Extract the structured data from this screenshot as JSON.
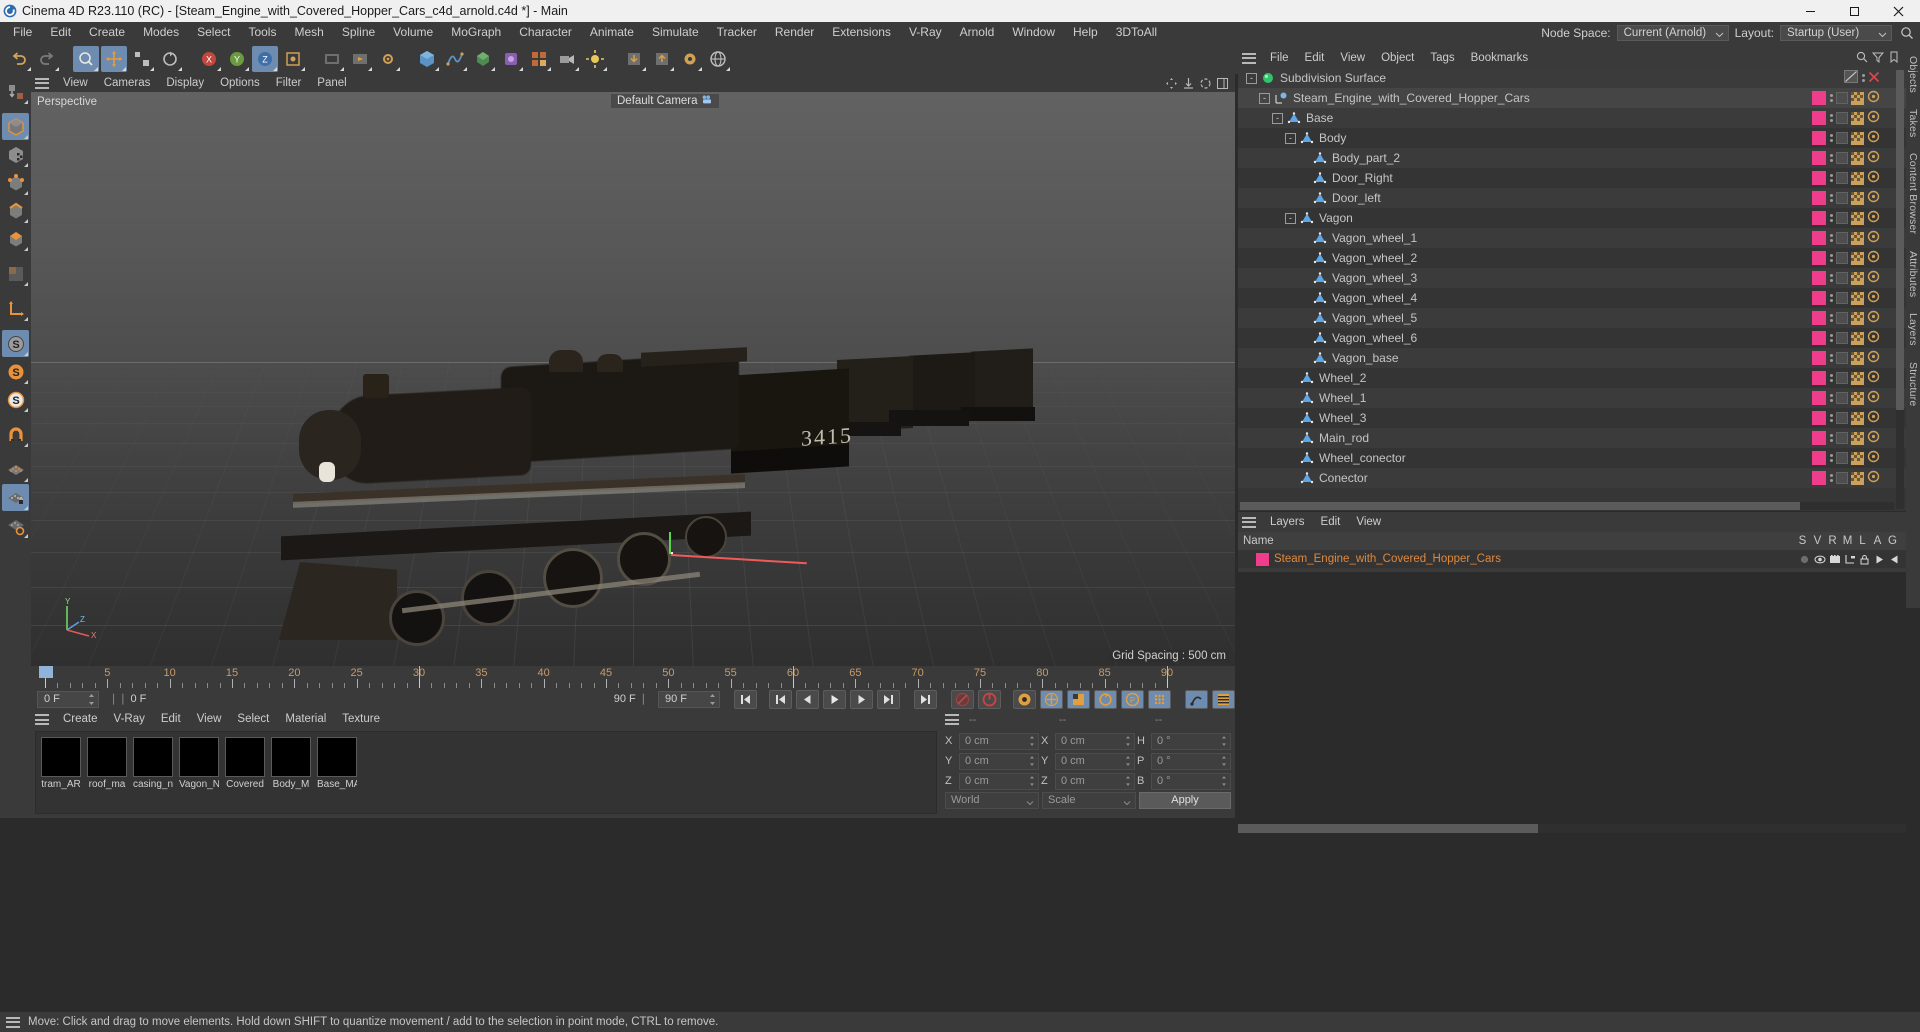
{
  "titlebar": {
    "title": "Cinema 4D R23.110 (RC) - [Steam_Engine_with_Covered_Hopper_Cars_c4d_arnold.c4d *] - Main",
    "minimize": "–",
    "maximize": "❐",
    "close": "✕"
  },
  "menubar": {
    "items": [
      "File",
      "Edit",
      "Create",
      "Modes",
      "Select",
      "Tools",
      "Mesh",
      "Spline",
      "Volume",
      "MoGraph",
      "Character",
      "Animate",
      "Simulate",
      "Tracker",
      "Render",
      "Extensions",
      "V-Ray",
      "Arnold",
      "Window",
      "Help",
      "3DToAll"
    ],
    "node_space_label": "Node Space:",
    "node_space_value": "Current (Arnold)",
    "layout_label": "Layout:",
    "layout_value": "Startup (User)"
  },
  "viewport": {
    "menus": [
      "View",
      "Cameras",
      "Display",
      "Options",
      "Filter",
      "Panel"
    ],
    "label": "Perspective",
    "camera": "Default Camera",
    "grid_spacing": "Grid Spacing : 500 cm",
    "axis": {
      "x": "X",
      "y": "Y",
      "z": "Z"
    }
  },
  "timeline": {
    "ticks": [
      0,
      5,
      10,
      15,
      20,
      25,
      30,
      35,
      40,
      45,
      50,
      55,
      60,
      65,
      70,
      75,
      80,
      85,
      90
    ],
    "current_frame": "0 F",
    "current_frame_2": "0 F",
    "end_frame_display": "90 F",
    "end_frame": "90 F",
    "preview_end": "0 F",
    "buttons": [
      "go-to-start",
      "previous-key",
      "previous-frame",
      "play",
      "next-frame",
      "next-key",
      "go-to-end",
      "record-active-objects",
      "autokeying",
      "keyframe-selection",
      "position",
      "scale",
      "rotation",
      "parameter",
      "point-level-animation",
      "animation-mode",
      "timeline-mode"
    ]
  },
  "material_manager": {
    "menus": [
      "Create",
      "V-Ray",
      "Edit",
      "View",
      "Select",
      "Material",
      "Texture"
    ],
    "materials": [
      {
        "name": "tram_AR",
        "color": "#000000"
      },
      {
        "name": "roof_ma",
        "color": "#000000"
      },
      {
        "name": "casing_n",
        "color": "#000000"
      },
      {
        "name": "Vagon_N",
        "color": "#000000"
      },
      {
        "name": "Covered",
        "color": "#000000"
      },
      {
        "name": "Body_M",
        "color": "#000000"
      },
      {
        "name": "Base_MA",
        "color": "#000000"
      }
    ]
  },
  "coordinates": {
    "header": [
      "--",
      "--",
      "--"
    ],
    "rows": [
      {
        "pos_label": "X",
        "pos_value": "0 cm",
        "size_label": "X",
        "size_value": "0 cm",
        "rot_label": "H",
        "rot_value": "0 °"
      },
      {
        "pos_label": "Y",
        "pos_value": "0 cm",
        "size_label": "Y",
        "size_value": "0 cm",
        "rot_label": "P",
        "rot_value": "0 °"
      },
      {
        "pos_label": "Z",
        "pos_value": "0 cm",
        "size_label": "Z",
        "size_value": "0 cm",
        "rot_label": "B",
        "rot_value": "0 °"
      }
    ],
    "system": "World",
    "mode": "Scale",
    "apply": "Apply"
  },
  "object_manager": {
    "menus": [
      "File",
      "Edit",
      "View",
      "Object",
      "Tags",
      "Bookmarks"
    ],
    "items": [
      {
        "name": "Subdivision Surface",
        "depth": 0,
        "icon": "subdivision-surface",
        "expander": "-",
        "selected": false,
        "tag": "none"
      },
      {
        "name": "Steam_Engine_with_Covered_Hopper_Cars",
        "depth": 1,
        "icon": "null-object",
        "expander": "-",
        "selected": true,
        "tag": "pink"
      },
      {
        "name": "Base",
        "depth": 2,
        "icon": "polygon-object",
        "expander": "-",
        "selected": false,
        "tag": "pink"
      },
      {
        "name": "Body",
        "depth": 3,
        "icon": "polygon-object",
        "expander": "-",
        "selected": false,
        "tag": "pink"
      },
      {
        "name": "Body_part_2",
        "depth": 4,
        "icon": "polygon-object",
        "expander": "",
        "selected": false,
        "tag": "pink"
      },
      {
        "name": "Door_Right",
        "depth": 4,
        "icon": "polygon-object",
        "expander": "",
        "selected": false,
        "tag": "pink"
      },
      {
        "name": "Door_left",
        "depth": 4,
        "icon": "polygon-object",
        "expander": "",
        "selected": false,
        "tag": "pink"
      },
      {
        "name": "Vagon",
        "depth": 3,
        "icon": "polygon-object",
        "expander": "-",
        "selected": false,
        "tag": "pink"
      },
      {
        "name": "Vagon_wheel_1",
        "depth": 4,
        "icon": "polygon-object",
        "expander": "",
        "selected": false,
        "tag": "pink"
      },
      {
        "name": "Vagon_wheel_2",
        "depth": 4,
        "icon": "polygon-object",
        "expander": "",
        "selected": false,
        "tag": "pink"
      },
      {
        "name": "Vagon_wheel_3",
        "depth": 4,
        "icon": "polygon-object",
        "expander": "",
        "selected": false,
        "tag": "pink"
      },
      {
        "name": "Vagon_wheel_4",
        "depth": 4,
        "icon": "polygon-object",
        "expander": "",
        "selected": false,
        "tag": "pink"
      },
      {
        "name": "Vagon_wheel_5",
        "depth": 4,
        "icon": "polygon-object",
        "expander": "",
        "selected": false,
        "tag": "pink"
      },
      {
        "name": "Vagon_wheel_6",
        "depth": 4,
        "icon": "polygon-object",
        "expander": "",
        "selected": false,
        "tag": "pink"
      },
      {
        "name": "Vagon_base",
        "depth": 4,
        "icon": "polygon-object",
        "expander": "",
        "selected": false,
        "tag": "pink"
      },
      {
        "name": "Wheel_2",
        "depth": 3,
        "icon": "polygon-object",
        "expander": "",
        "selected": false,
        "tag": "pink"
      },
      {
        "name": "Wheel_1",
        "depth": 3,
        "icon": "polygon-object",
        "expander": "",
        "selected": false,
        "tag": "pink"
      },
      {
        "name": "Wheel_3",
        "depth": 3,
        "icon": "polygon-object",
        "expander": "",
        "selected": false,
        "tag": "pink"
      },
      {
        "name": "Main_rod",
        "depth": 3,
        "icon": "polygon-object",
        "expander": "",
        "selected": false,
        "tag": "pink"
      },
      {
        "name": "Wheel_conector",
        "depth": 3,
        "icon": "polygon-object",
        "expander": "",
        "selected": false,
        "tag": "pink"
      },
      {
        "name": "Conector",
        "depth": 3,
        "icon": "polygon-object",
        "expander": "",
        "selected": false,
        "tag": "pink"
      }
    ]
  },
  "layers": {
    "menus": [
      "Layers",
      "Edit",
      "View"
    ],
    "name_header": "Name",
    "columns": [
      "S",
      "V",
      "R",
      "M",
      "L",
      "A",
      "G"
    ],
    "rows": [
      {
        "name": "Steam_Engine_with_Covered_Hopper_Cars",
        "color": "#ee3d8b"
      }
    ]
  },
  "right_tabs": [
    "Objects",
    "Takes",
    "Content Browser",
    "Attributes",
    "Layers",
    "Structure"
  ],
  "statusbar": {
    "message": "Move: Click and drag to move elements. Hold down SHIFT to quantize movement / add to the selection in point mode, CTRL to remove."
  },
  "colors": {
    "accent_pink": "#ee3d8b",
    "accent_orange": "#e0883c",
    "selection_blue": "#6d8cb0",
    "panel_bg": "#3a3a3a",
    "list_bg": "#363636",
    "tick_text": "#c79b6a"
  }
}
